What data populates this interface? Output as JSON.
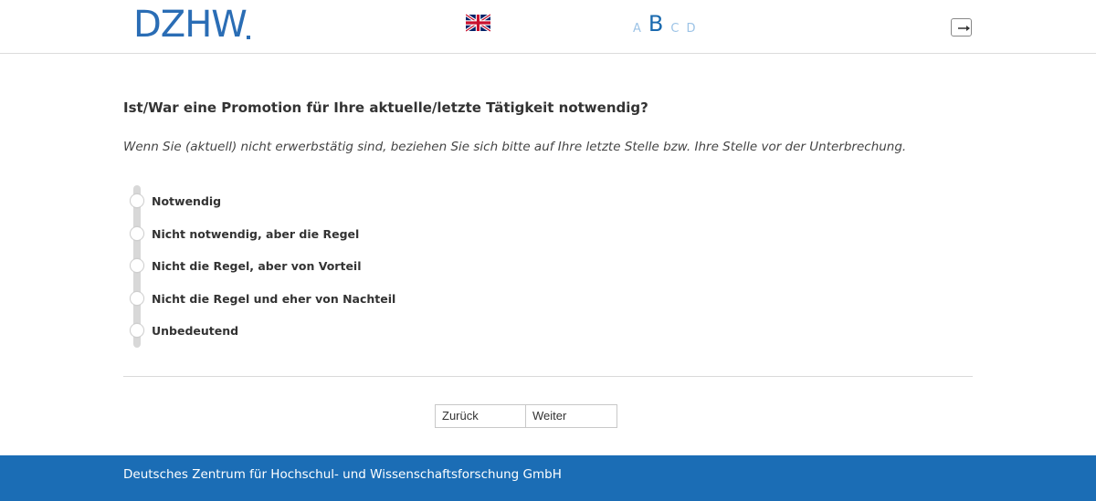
{
  "header": {
    "logo_text": "DZHW",
    "language_flag_icon": "uk-flag-icon",
    "modules": [
      {
        "label": "A",
        "active": false
      },
      {
        "label": "B",
        "active": true
      },
      {
        "label": "C",
        "active": false
      },
      {
        "label": "D",
        "active": false
      }
    ],
    "exit_icon": "exit-arrow-icon"
  },
  "main": {
    "question": "Ist/War eine Promotion für Ihre aktuelle/letzte Tätigkeit notwendig?",
    "instruction": "Wenn Sie (aktuell) nicht erwerbstätig sind, beziehen Sie sich bitte auf Ihre letzte Stelle bzw. Ihre Stelle vor der Unterbrechung.",
    "options": [
      {
        "label": "Notwendig"
      },
      {
        "label": "Nicht notwendig, aber die Regel"
      },
      {
        "label": "Nicht die Regel, aber von Vorteil"
      },
      {
        "label": "Nicht die Regel und eher von Nachteil"
      },
      {
        "label": "Unbedeutend"
      }
    ],
    "back_label": "Zurück",
    "next_label": "Weiter"
  },
  "footer": {
    "text": "Deutsches Zentrum für Hochschul- und Wissenschaftsforschung GmbH"
  },
  "colors": {
    "brand_blue": "#1b6db5",
    "active_module": "#1a6aaf",
    "inactive_module": "#9cc3e6"
  }
}
